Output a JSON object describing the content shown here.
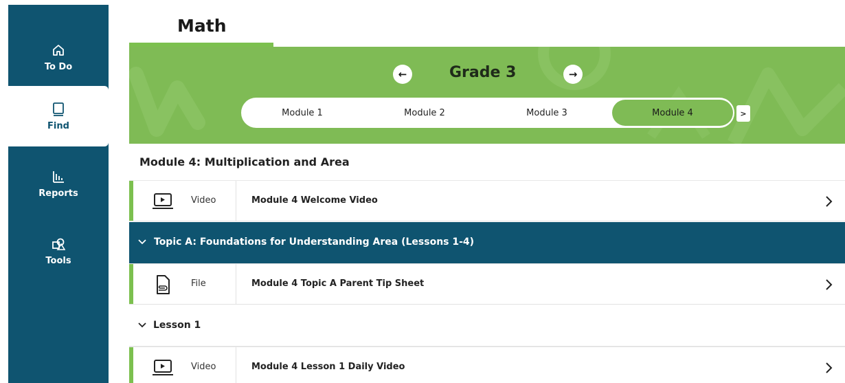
{
  "sidebar": {
    "items": [
      {
        "label": "To Do",
        "icon": "home-icon"
      },
      {
        "label": "Find",
        "icon": "book-icon",
        "active": true
      },
      {
        "label": "Reports",
        "icon": "bar-chart-icon"
      },
      {
        "label": "Tools",
        "icon": "shapes-icon"
      }
    ]
  },
  "header": {
    "title": "Math"
  },
  "banner": {
    "grade": "Grade 3",
    "modules": [
      "Module 1",
      "Module 2",
      "Module 3",
      "Module 4"
    ],
    "selected_module": "Module 4",
    "more_label": ">"
  },
  "content": {
    "module_heading": "Module 4: Multiplication and Area",
    "rows": [
      {
        "type": "Video",
        "title": "Module 4 Welcome Video"
      },
      {
        "type": "File",
        "title": "Module 4 Topic A Parent Tip Sheet"
      },
      {
        "type": "Video",
        "title": "Module 4 Lesson 1 Daily Video"
      }
    ],
    "topic": "Topic A: Foundations for Understanding Area (Lessons 1-4)",
    "lesson": "Lesson 1"
  },
  "colors": {
    "navy": "#0f5470",
    "green": "#7fbb55",
    "accent_green": "#7cc04f"
  }
}
